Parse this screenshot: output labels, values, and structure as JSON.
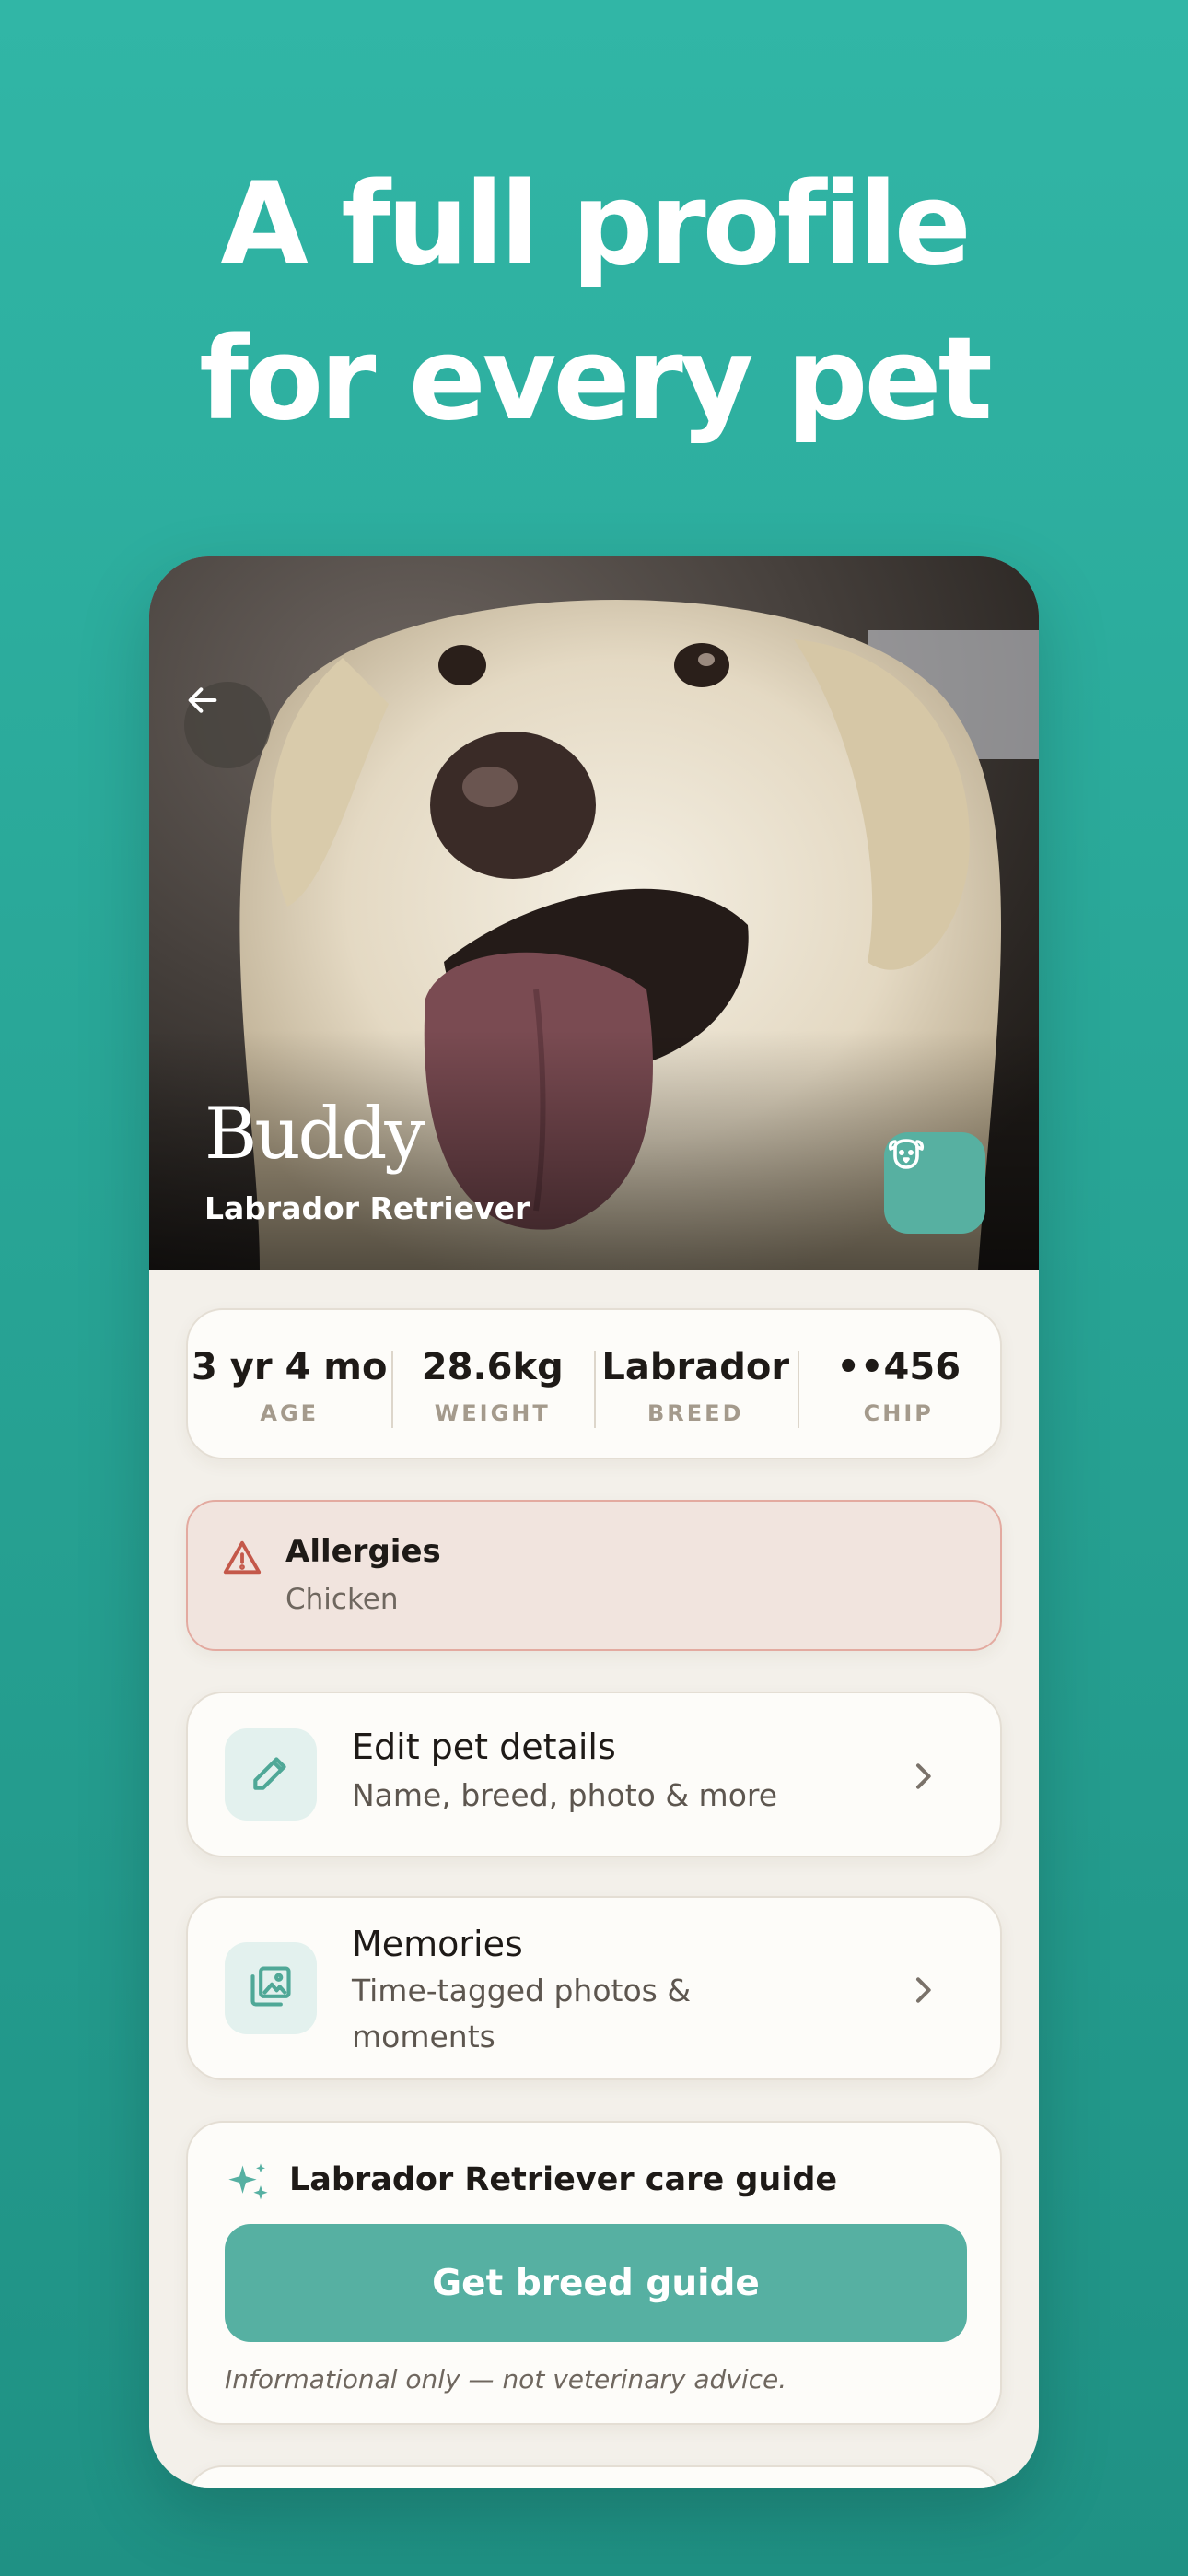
{
  "headline": {
    "line1": "A full profile",
    "line2": "for every pet"
  },
  "pet": {
    "name": "Buddy",
    "breed": "Labrador Retriever"
  },
  "icons": {
    "back": "arrow-left-icon",
    "species": "dog-face-icon",
    "allergy": "warning-triangle-icon",
    "edit": "pencil-icon",
    "memories": "photo-library-icon",
    "chevron": "chevron-right-icon",
    "guide": "sparkles-icon"
  },
  "stats": [
    {
      "value": "3 yr 4 mo",
      "label": "AGE"
    },
    {
      "value": "28.6kg",
      "label": "WEIGHT"
    },
    {
      "value": "Labrador",
      "label": "BREED"
    },
    {
      "value": "••456",
      "label": "CHIP"
    }
  ],
  "allergy": {
    "title": "Allergies",
    "value": "Chicken"
  },
  "rows": {
    "edit": {
      "title": "Edit pet details",
      "subtitle": "Name, breed, photo & more"
    },
    "memories": {
      "title": "Memories",
      "subtitle": "Time-tagged photos & moments"
    }
  },
  "guide": {
    "title": "Labrador Retriever care guide",
    "button": "Get breed guide",
    "note": "Informational only — not veterinary advice."
  },
  "colors": {
    "brand_teal": "#31b6a6",
    "button_teal": "#56b0a2",
    "alert_bg": "#f1e4de",
    "alert_icon": "#c4584a"
  }
}
